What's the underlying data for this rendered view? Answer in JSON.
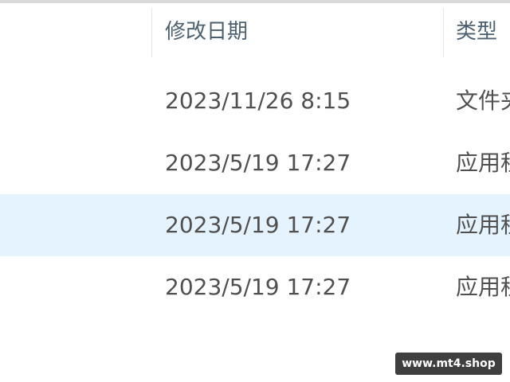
{
  "header": {
    "columns": [
      {
        "label": "修改日期"
      },
      {
        "label": "类型"
      }
    ]
  },
  "rows": [
    {
      "modified": "2023/11/26 8:15",
      "type": "文件夹",
      "selected": false
    },
    {
      "modified": "2023/5/19 17:27",
      "type": "应用程序",
      "selected": false
    },
    {
      "modified": "2023/5/19 17:27",
      "type": "应用程序",
      "selected": true
    },
    {
      "modified": "2023/5/19 17:27",
      "type": "应用程序",
      "selected": false
    }
  ],
  "watermark": {
    "text": "www.mt4.shop"
  },
  "colors": {
    "selected_row": "#e5f3ff",
    "header_text": "#4c6072",
    "cell_text": "#505050"
  }
}
